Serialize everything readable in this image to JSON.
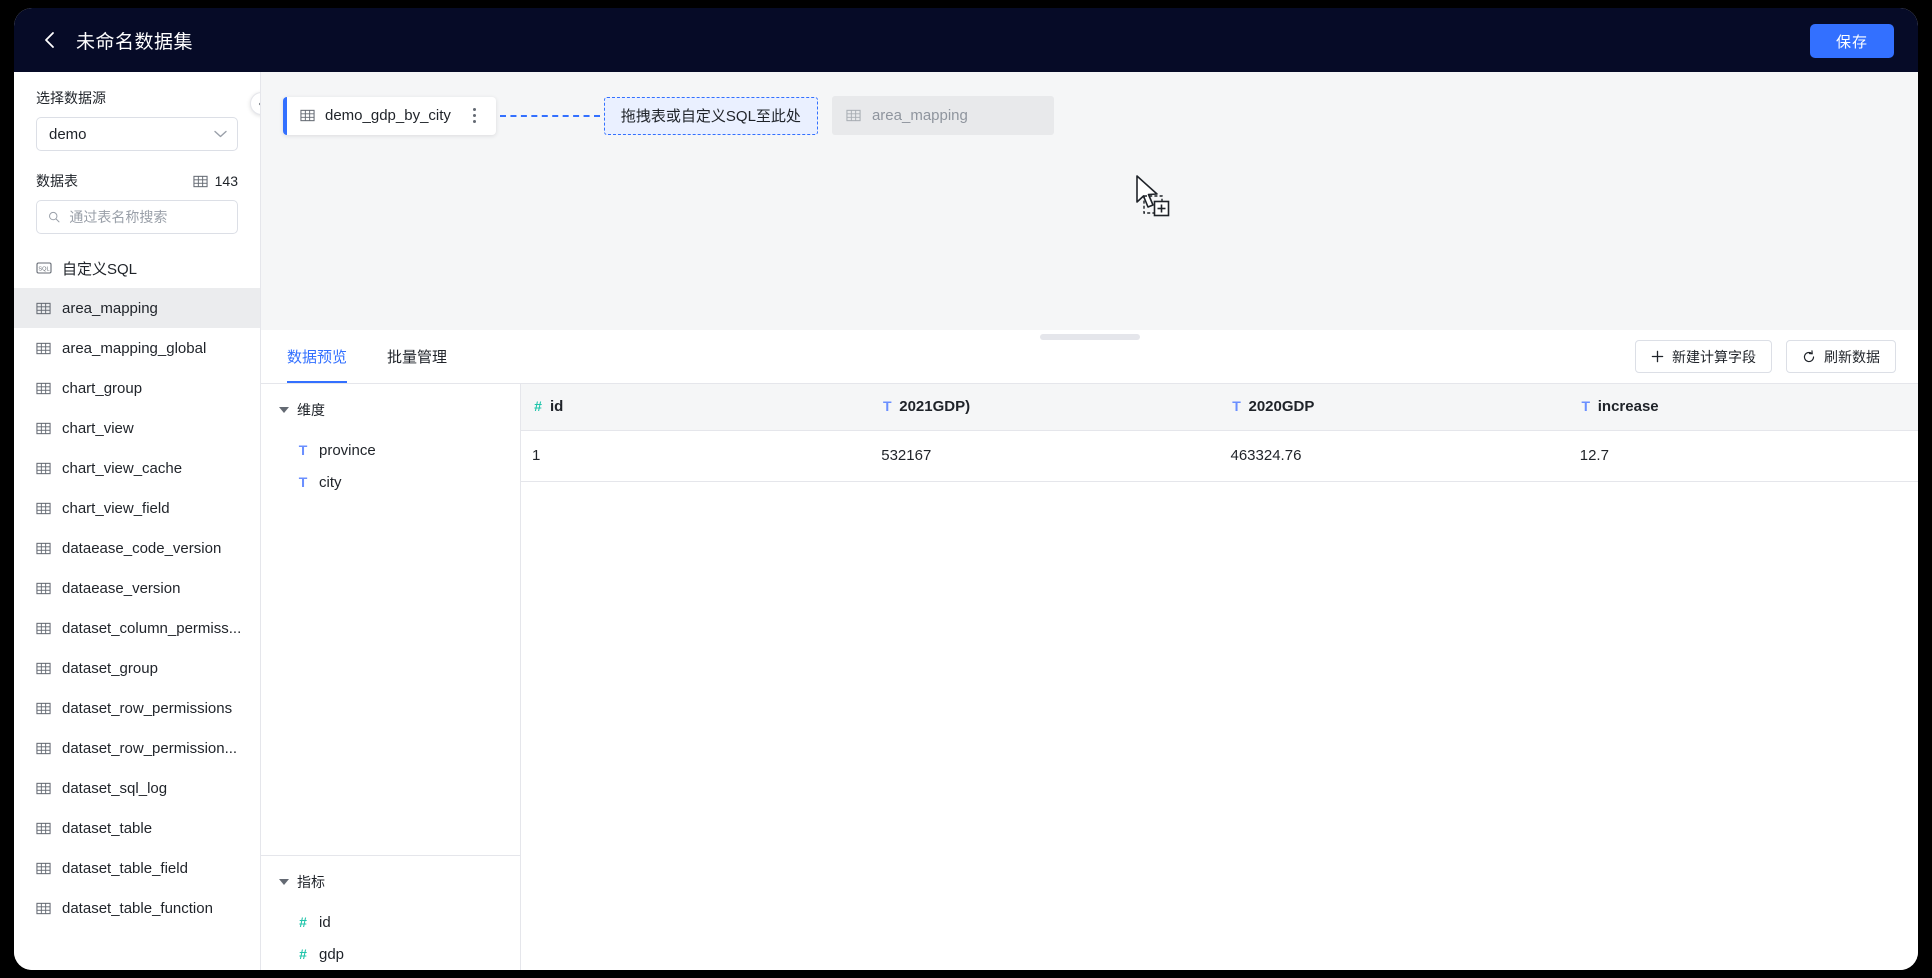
{
  "header": {
    "back_icon": "chevron-left-icon",
    "title": "未命名数据集",
    "save_label": "保存"
  },
  "sidebar": {
    "datasource_label": "选择数据源",
    "datasource_value": "demo",
    "tables_label": "数据表",
    "tables_count": "143",
    "search_placeholder": "通过表名称搜索",
    "search_value": "",
    "custom_sql_label": "自定义SQL",
    "collapse_icon": "chevron-left-icon",
    "items": [
      {
        "label": "area_mapping",
        "active": true
      },
      {
        "label": "area_mapping_global",
        "active": false
      },
      {
        "label": "chart_group",
        "active": false
      },
      {
        "label": "chart_view",
        "active": false
      },
      {
        "label": "chart_view_cache",
        "active": false
      },
      {
        "label": "chart_view_field",
        "active": false
      },
      {
        "label": "dataease_code_version",
        "active": false
      },
      {
        "label": "dataease_version",
        "active": false
      },
      {
        "label": "dataset_column_permiss...",
        "active": false
      },
      {
        "label": "dataset_group",
        "active": false
      },
      {
        "label": "dataset_row_permissions",
        "active": false
      },
      {
        "label": "dataset_row_permission...",
        "active": false
      },
      {
        "label": "dataset_sql_log",
        "active": false
      },
      {
        "label": "dataset_table",
        "active": false
      },
      {
        "label": "dataset_table_field",
        "active": false
      },
      {
        "label": "dataset_table_function",
        "active": false
      }
    ]
  },
  "canvas": {
    "node_label": "demo_gdp_by_city",
    "dropzone_label": "拖拽表或自定义SQL至此处",
    "ghost_label": "area_mapping"
  },
  "lower": {
    "tabs": [
      {
        "label": "数据预览",
        "active": true
      },
      {
        "label": "批量管理",
        "active": false
      }
    ],
    "new_field_label": "新建计算字段",
    "refresh_label": "刷新数据",
    "dimension_group": {
      "title": "维度",
      "fields": [
        {
          "label": "province",
          "type": "T"
        },
        {
          "label": "city",
          "type": "T"
        }
      ]
    },
    "metric_group": {
      "title": "指标",
      "fields": [
        {
          "label": "id",
          "type": "#"
        },
        {
          "label": "gdp",
          "type": "#"
        }
      ]
    },
    "table": {
      "columns": [
        {
          "label": "id",
          "type": "#"
        },
        {
          "label": "2021GDP)",
          "type": "T"
        },
        {
          "label": "2020GDP",
          "type": "T"
        },
        {
          "label": "increase",
          "type": "T"
        }
      ],
      "rows": [
        [
          "1",
          "532167",
          "463324.76",
          "12.7"
        ]
      ]
    }
  },
  "colors": {
    "accent": "#3370ff",
    "header_bg": "#060b27",
    "canvas_bg": "#f5f6f7",
    "metric_green": "#21c5ab",
    "dim_blue": "#6a8fff"
  }
}
